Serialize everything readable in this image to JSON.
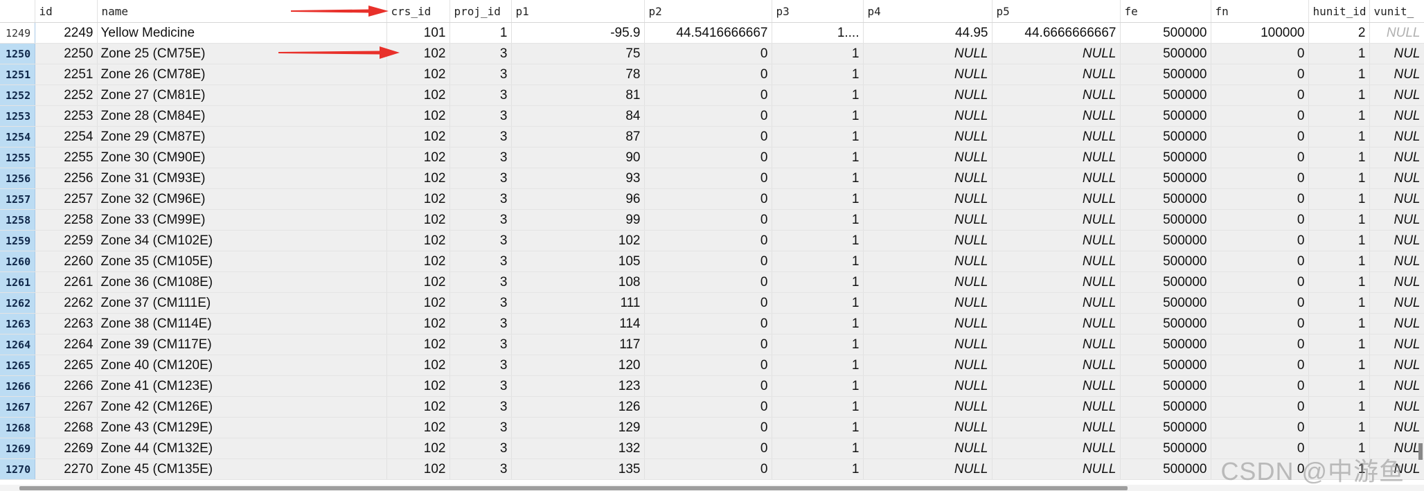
{
  "columns": [
    "id",
    "name",
    "crs_id",
    "proj_id",
    "p1",
    "p2",
    "p3",
    "p4",
    "p5",
    "fe",
    "fn",
    "hunit_id",
    "vunit_"
  ],
  "rows": [
    {
      "rn": "1249",
      "id": "2249",
      "name": "Yellow Medicine",
      "crs_id": "101",
      "proj_id": "1",
      "p1": "-95.9",
      "p2": "44.5416666667",
      "p3": "1....",
      "p4": "44.95",
      "p5": "44.6666666667",
      "fe": "500000",
      "fn": "100000",
      "hunit_id": "2",
      "vunit": "NULL"
    },
    {
      "rn": "1250",
      "id": "2250",
      "name": "Zone 25 (CM75E)",
      "crs_id": "102",
      "proj_id": "3",
      "p1": "75",
      "p2": "0",
      "p3": "1",
      "p4": "NULL",
      "p5": "NULL",
      "fe": "500000",
      "fn": "0",
      "hunit_id": "1",
      "vunit": "NUL"
    },
    {
      "rn": "1251",
      "id": "2251",
      "name": "Zone 26 (CM78E)",
      "crs_id": "102",
      "proj_id": "3",
      "p1": "78",
      "p2": "0",
      "p3": "1",
      "p4": "NULL",
      "p5": "NULL",
      "fe": "500000",
      "fn": "0",
      "hunit_id": "1",
      "vunit": "NUL"
    },
    {
      "rn": "1252",
      "id": "2252",
      "name": "Zone 27 (CM81E)",
      "crs_id": "102",
      "proj_id": "3",
      "p1": "81",
      "p2": "0",
      "p3": "1",
      "p4": "NULL",
      "p5": "NULL",
      "fe": "500000",
      "fn": "0",
      "hunit_id": "1",
      "vunit": "NUL"
    },
    {
      "rn": "1253",
      "id": "2253",
      "name": "Zone 28 (CM84E)",
      "crs_id": "102",
      "proj_id": "3",
      "p1": "84",
      "p2": "0",
      "p3": "1",
      "p4": "NULL",
      "p5": "NULL",
      "fe": "500000",
      "fn": "0",
      "hunit_id": "1",
      "vunit": "NUL"
    },
    {
      "rn": "1254",
      "id": "2254",
      "name": "Zone 29 (CM87E)",
      "crs_id": "102",
      "proj_id": "3",
      "p1": "87",
      "p2": "0",
      "p3": "1",
      "p4": "NULL",
      "p5": "NULL",
      "fe": "500000",
      "fn": "0",
      "hunit_id": "1",
      "vunit": "NUL"
    },
    {
      "rn": "1255",
      "id": "2255",
      "name": "Zone 30 (CM90E)",
      "crs_id": "102",
      "proj_id": "3",
      "p1": "90",
      "p2": "0",
      "p3": "1",
      "p4": "NULL",
      "p5": "NULL",
      "fe": "500000",
      "fn": "0",
      "hunit_id": "1",
      "vunit": "NUL"
    },
    {
      "rn": "1256",
      "id": "2256",
      "name": "Zone 31 (CM93E)",
      "crs_id": "102",
      "proj_id": "3",
      "p1": "93",
      "p2": "0",
      "p3": "1",
      "p4": "NULL",
      "p5": "NULL",
      "fe": "500000",
      "fn": "0",
      "hunit_id": "1",
      "vunit": "NUL"
    },
    {
      "rn": "1257",
      "id": "2257",
      "name": "Zone 32 (CM96E)",
      "crs_id": "102",
      "proj_id": "3",
      "p1": "96",
      "p2": "0",
      "p3": "1",
      "p4": "NULL",
      "p5": "NULL",
      "fe": "500000",
      "fn": "0",
      "hunit_id": "1",
      "vunit": "NUL"
    },
    {
      "rn": "1258",
      "id": "2258",
      "name": "Zone 33 (CM99E)",
      "crs_id": "102",
      "proj_id": "3",
      "p1": "99",
      "p2": "0",
      "p3": "1",
      "p4": "NULL",
      "p5": "NULL",
      "fe": "500000",
      "fn": "0",
      "hunit_id": "1",
      "vunit": "NUL"
    },
    {
      "rn": "1259",
      "id": "2259",
      "name": "Zone 34 (CM102E)",
      "crs_id": "102",
      "proj_id": "3",
      "p1": "102",
      "p2": "0",
      "p3": "1",
      "p4": "NULL",
      "p5": "NULL",
      "fe": "500000",
      "fn": "0",
      "hunit_id": "1",
      "vunit": "NUL"
    },
    {
      "rn": "1260",
      "id": "2260",
      "name": "Zone 35 (CM105E)",
      "crs_id": "102",
      "proj_id": "3",
      "p1": "105",
      "p2": "0",
      "p3": "1",
      "p4": "NULL",
      "p5": "NULL",
      "fe": "500000",
      "fn": "0",
      "hunit_id": "1",
      "vunit": "NUL"
    },
    {
      "rn": "1261",
      "id": "2261",
      "name": "Zone 36 (CM108E)",
      "crs_id": "102",
      "proj_id": "3",
      "p1": "108",
      "p2": "0",
      "p3": "1",
      "p4": "NULL",
      "p5": "NULL",
      "fe": "500000",
      "fn": "0",
      "hunit_id": "1",
      "vunit": "NUL"
    },
    {
      "rn": "1262",
      "id": "2262",
      "name": "Zone 37 (CM111E)",
      "crs_id": "102",
      "proj_id": "3",
      "p1": "111",
      "p2": "0",
      "p3": "1",
      "p4": "NULL",
      "p5": "NULL",
      "fe": "500000",
      "fn": "0",
      "hunit_id": "1",
      "vunit": "NUL"
    },
    {
      "rn": "1263",
      "id": "2263",
      "name": "Zone 38 (CM114E)",
      "crs_id": "102",
      "proj_id": "3",
      "p1": "114",
      "p2": "0",
      "p3": "1",
      "p4": "NULL",
      "p5": "NULL",
      "fe": "500000",
      "fn": "0",
      "hunit_id": "1",
      "vunit": "NUL"
    },
    {
      "rn": "1264",
      "id": "2264",
      "name": "Zone 39 (CM117E)",
      "crs_id": "102",
      "proj_id": "3",
      "p1": "117",
      "p2": "0",
      "p3": "1",
      "p4": "NULL",
      "p5": "NULL",
      "fe": "500000",
      "fn": "0",
      "hunit_id": "1",
      "vunit": "NUL"
    },
    {
      "rn": "1265",
      "id": "2265",
      "name": "Zone 40 (CM120E)",
      "crs_id": "102",
      "proj_id": "3",
      "p1": "120",
      "p2": "0",
      "p3": "1",
      "p4": "NULL",
      "p5": "NULL",
      "fe": "500000",
      "fn": "0",
      "hunit_id": "1",
      "vunit": "NUL"
    },
    {
      "rn": "1266",
      "id": "2266",
      "name": "Zone 41 (CM123E)",
      "crs_id": "102",
      "proj_id": "3",
      "p1": "123",
      "p2": "0",
      "p3": "1",
      "p4": "NULL",
      "p5": "NULL",
      "fe": "500000",
      "fn": "0",
      "hunit_id": "1",
      "vunit": "NUL"
    },
    {
      "rn": "1267",
      "id": "2267",
      "name": "Zone 42 (CM126E)",
      "crs_id": "102",
      "proj_id": "3",
      "p1": "126",
      "p2": "0",
      "p3": "1",
      "p4": "NULL",
      "p5": "NULL",
      "fe": "500000",
      "fn": "0",
      "hunit_id": "1",
      "vunit": "NUL"
    },
    {
      "rn": "1268",
      "id": "2268",
      "name": "Zone 43 (CM129E)",
      "crs_id": "102",
      "proj_id": "3",
      "p1": "129",
      "p2": "0",
      "p3": "1",
      "p4": "NULL",
      "p5": "NULL",
      "fe": "500000",
      "fn": "0",
      "hunit_id": "1",
      "vunit": "NUL"
    },
    {
      "rn": "1269",
      "id": "2269",
      "name": "Zone 44 (CM132E)",
      "crs_id": "102",
      "proj_id": "3",
      "p1": "132",
      "p2": "0",
      "p3": "1",
      "p4": "NULL",
      "p5": "NULL",
      "fe": "500000",
      "fn": "0",
      "hunit_id": "1",
      "vunit": "NUL"
    },
    {
      "rn": "1270",
      "id": "2270",
      "name": "Zone 45 (CM135E)",
      "crs_id": "102",
      "proj_id": "3",
      "p1": "135",
      "p2": "0",
      "p3": "1",
      "p4": "NULL",
      "p5": "NULL",
      "fe": "500000",
      "fn": "0",
      "hunit_id": "1",
      "vunit": "NUL"
    }
  ],
  "watermark": "CSDN @中游鱼",
  "colors": {
    "arrow": "#e8302a",
    "row_number_selected": "#bcdcf3",
    "row_bg": "#efefef"
  },
  "icons": [
    "arrow-icon"
  ]
}
